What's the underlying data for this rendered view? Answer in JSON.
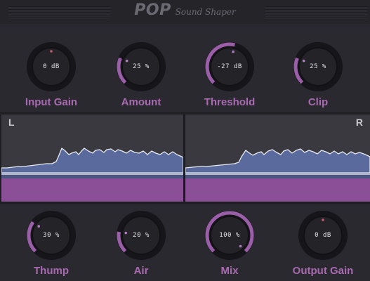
{
  "plugin": {
    "name": "POP",
    "subtitle": "Sound Shaper"
  },
  "knobs_top": [
    {
      "label": "Input Gain",
      "value": "0 dB",
      "fraction": 0.5,
      "mode": "bipolar"
    },
    {
      "label": "Amount",
      "value": "25 %",
      "fraction": 0.25,
      "mode": "unipolar"
    },
    {
      "label": "Threshold",
      "value": "-27 dB",
      "fraction": 0.55,
      "mode": "unipolar"
    },
    {
      "label": "Clip",
      "value": "25 %",
      "fraction": 0.25,
      "mode": "unipolar"
    }
  ],
  "knobs_bottom": [
    {
      "label": "Thump",
      "value": "30 %",
      "fraction": 0.3,
      "mode": "unipolar"
    },
    {
      "label": "Air",
      "value": "20 %",
      "fraction": 0.2,
      "mode": "unipolar"
    },
    {
      "label": "Mix",
      "value": "100 %",
      "fraction": 1.0,
      "mode": "unipolar"
    },
    {
      "label": "Output Gain",
      "value": "0 dB",
      "fraction": 0.5,
      "mode": "bipolar"
    }
  ],
  "scope": {
    "left_label": "L",
    "right_label": "R"
  },
  "colors": {
    "accent": "#9b5ea9",
    "label": "#a96ab2",
    "waveform": "#5a6a9c",
    "waveform_line": "#e8eaf2",
    "bottom_band": "#8b4f97",
    "background": "#2a292f"
  }
}
